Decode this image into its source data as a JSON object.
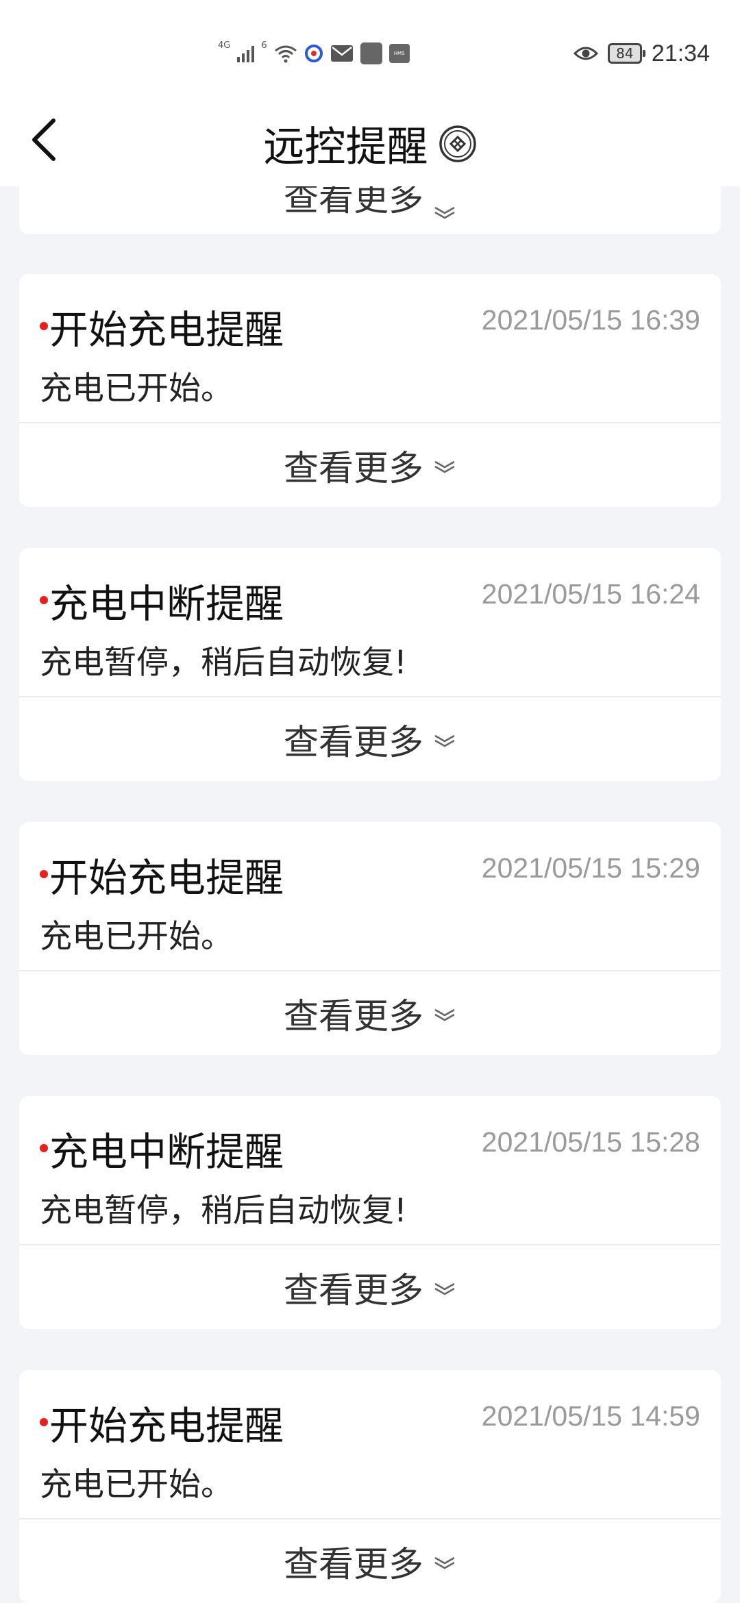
{
  "status_bar": {
    "network_type": "4G",
    "network_type_2": "6",
    "hms_label": "HMS",
    "battery_level": "84",
    "time": "21:34"
  },
  "header": {
    "title": "远控提醒"
  },
  "partial_card": {
    "more_label": "查看更多"
  },
  "cards": [
    {
      "title": "开始充电提醒",
      "time": "2021/05/15 16:39",
      "body": "充电已开始。",
      "more_label": "查看更多"
    },
    {
      "title": "充电中断提醒",
      "time": "2021/05/15 16:24",
      "body": "充电暂停，稍后自动恢复!",
      "more_label": "查看更多"
    },
    {
      "title": "开始充电提醒",
      "time": "2021/05/15 15:29",
      "body": "充电已开始。",
      "more_label": "查看更多"
    },
    {
      "title": "充电中断提醒",
      "time": "2021/05/15 15:28",
      "body": "充电暂停，稍后自动恢复!",
      "more_label": "查看更多"
    },
    {
      "title": "开始充电提醒",
      "time": "2021/05/15 14:59",
      "body": "充电已开始。",
      "more_label": "查看更多"
    }
  ],
  "colors": {
    "unread_dot": "#e61f1f",
    "time_text": "#9a9a9a",
    "page_background": "#f3f4f8"
  }
}
